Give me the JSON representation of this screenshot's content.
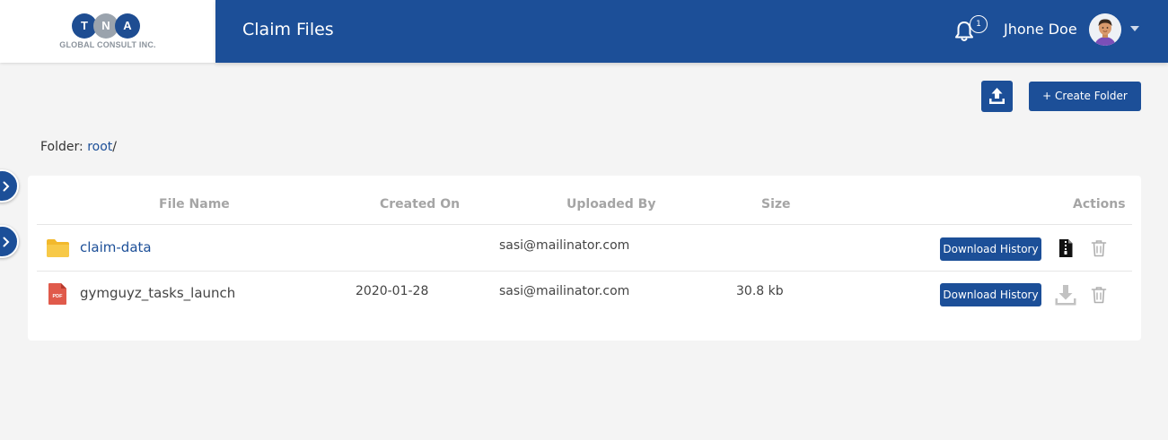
{
  "logo": {
    "letters": [
      "T",
      "N",
      "A"
    ],
    "subtitle": "GLOBAL CONSULT INC."
  },
  "header": {
    "title": "Claim Files",
    "notification_count": "1",
    "user_name": "Jhone Doe"
  },
  "toolbar": {
    "create_folder_label": "+ Create Folder"
  },
  "breadcrumb": {
    "label": "Folder: ",
    "root": "root",
    "separator": "/"
  },
  "table": {
    "columns": {
      "file_name": "File Name",
      "created_on": "Created On",
      "uploaded_by": "Uploaded By",
      "size": "Size",
      "actions": "Actions"
    },
    "rows": [
      {
        "type": "folder",
        "name": "claim-data",
        "created_on": "",
        "uploaded_by": "sasi@mailinator.com",
        "size": "",
        "download_history_label": "Download History"
      },
      {
        "type": "pdf",
        "name": "gymguyz_tasks_launch",
        "created_on": "2020-01-28",
        "uploaded_by": "sasi@mailinator.com",
        "size": "30.8 kb",
        "download_history_label": "Download History"
      }
    ]
  },
  "colors": {
    "primary": "#1c4f98",
    "background": "#f4f4f4",
    "folder": "#f7c948",
    "pdf": "#e05a4b"
  },
  "icons": [
    "bell-icon",
    "avatar",
    "caret-down-icon",
    "upload-icon",
    "chevron-right-icon",
    "folder-icon",
    "pdf-icon",
    "zip-file-icon",
    "download-icon",
    "trash-icon"
  ]
}
